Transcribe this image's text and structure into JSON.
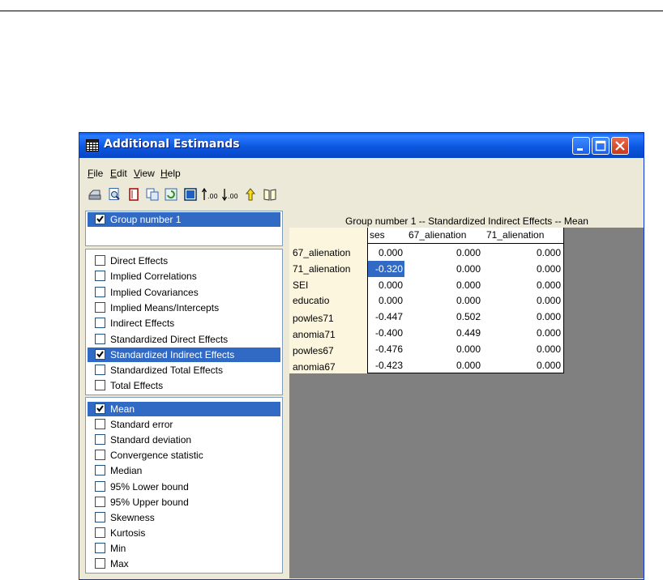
{
  "window": {
    "title": "Additional Estimands",
    "buttons": [
      "minimize",
      "maximize",
      "close"
    ]
  },
  "menu": [
    {
      "label": "File",
      "u": "F",
      "rest": "ile"
    },
    {
      "label": "Edit",
      "u": "E",
      "rest": "dit"
    },
    {
      "label": "View",
      "u": "V",
      "rest": "iew"
    },
    {
      "label": "Help",
      "u": "H",
      "rest": "elp"
    }
  ],
  "toolbar": [
    "print-icon",
    "preview-icon",
    "copy-icon",
    "copy-all-icon",
    "refresh-icon",
    "table-icon",
    "increase-decimals-icon",
    "decrease-decimals-icon",
    "rotate-icon",
    "help-book-icon"
  ],
  "groups": {
    "items": [
      {
        "label": "Group number 1",
        "checked": true,
        "selected": true
      }
    ]
  },
  "estimands": {
    "items": [
      {
        "label": "Direct Effects",
        "checked": false,
        "selected": false
      },
      {
        "label": "Implied Correlations",
        "checked": false,
        "selected": false
      },
      {
        "label": "Implied Covariances",
        "checked": false,
        "selected": false
      },
      {
        "label": "Implied Means/Intercepts",
        "checked": false,
        "selected": false
      },
      {
        "label": "Indirect Effects",
        "checked": false,
        "selected": false
      },
      {
        "label": "Standardized Direct Effects",
        "checked": false,
        "selected": false
      },
      {
        "label": "Standardized Indirect Effects",
        "checked": true,
        "selected": true
      },
      {
        "label": "Standardized Total Effects",
        "checked": false,
        "selected": false
      },
      {
        "label": "Total Effects",
        "checked": false,
        "selected": false
      }
    ]
  },
  "statistics": {
    "items": [
      {
        "label": "Mean",
        "checked": true,
        "selected": true
      },
      {
        "label": "Standard error",
        "checked": false,
        "selected": false
      },
      {
        "label": "Standard deviation",
        "checked": false,
        "selected": false
      },
      {
        "label": "Convergence statistic",
        "checked": false,
        "selected": false
      },
      {
        "label": "Median",
        "checked": false,
        "selected": false
      },
      {
        "label": "95% Lower bound",
        "checked": false,
        "selected": false
      },
      {
        "label": "95% Upper bound",
        "checked": false,
        "selected": false
      },
      {
        "label": "Skewness",
        "checked": false,
        "selected": false
      },
      {
        "label": "Kurtosis",
        "checked": false,
        "selected": false
      },
      {
        "label": "Min",
        "checked": false,
        "selected": false
      },
      {
        "label": "Max",
        "checked": false,
        "selected": false
      }
    ]
  },
  "results": {
    "title": "Group number 1 -- Standardized Indirect Effects -- Mean",
    "columns": [
      "ses",
      "67_alienation",
      "71_alienation"
    ],
    "rows": [
      {
        "label": "67_alienation",
        "values": [
          "0.000",
          "0.000",
          "0.000"
        ]
      },
      {
        "label": "71_alienation",
        "values": [
          "-0.320",
          "0.000",
          "0.000"
        ]
      },
      {
        "label": "SEI",
        "values": [
          "0.000",
          "0.000",
          "0.000"
        ]
      },
      {
        "label": "educatio",
        "values": [
          "0.000",
          "0.000",
          "0.000"
        ]
      },
      {
        "label": "powles71",
        "values": [
          "-0.447",
          "0.502",
          "0.000"
        ]
      },
      {
        "label": "anomia71",
        "values": [
          "-0.400",
          "0.449",
          "0.000"
        ]
      },
      {
        "label": "powles67",
        "values": [
          "-0.476",
          "0.000",
          "0.000"
        ]
      },
      {
        "label": "anomia67",
        "values": [
          "-0.423",
          "0.000",
          "0.000"
        ]
      }
    ],
    "selected_cell": {
      "row": 1,
      "col": 0
    }
  }
}
